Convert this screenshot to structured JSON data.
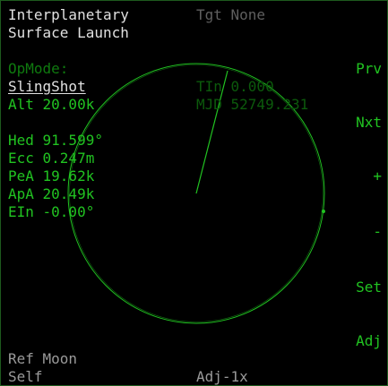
{
  "header": {
    "title_line1": "Interplanetary",
    "title_line2": "Surface Launch",
    "target": "Tgt None"
  },
  "opmode": {
    "label": "OpMode:",
    "value": "SlingShot"
  },
  "params": {
    "alt": "Alt 20.00k",
    "tin": "TIn 0.000",
    "mjd": "MJD 52749.231",
    "hed": "Hed 91.599°",
    "ecc": "Ecc 0.247m",
    "pea": "PeA 19.62k",
    "apa": "ApA 20.49k",
    "ein": "EIn -0.00°"
  },
  "buttons": {
    "prv": "Prv",
    "nxt": "Nxt",
    "plus": "+",
    "minus": "-",
    "set": "Set",
    "adj": "Adj"
  },
  "footer": {
    "ref": "Ref Moon",
    "self": "Self",
    "adj_step": "Adj-1x"
  },
  "colors": {
    "text_white": "#e0e0e0",
    "text_green": "#21c321",
    "text_dim": "#0c5a0c",
    "orbit": "#21c321"
  }
}
